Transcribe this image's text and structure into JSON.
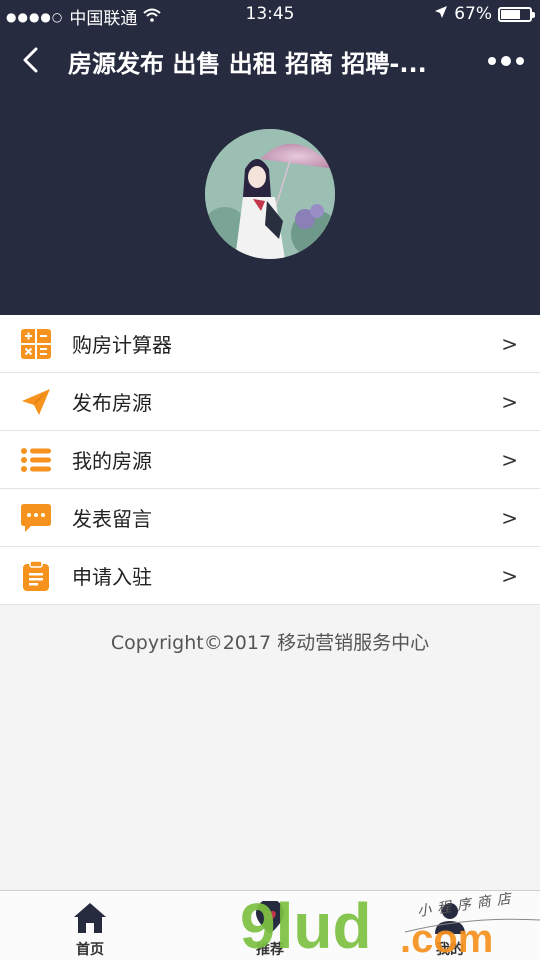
{
  "status_bar": {
    "signal": "●●●●○",
    "carrier": "中国联通",
    "time": "13:45",
    "battery": "67%",
    "battery_level": 0.67
  },
  "nav": {
    "title": "房源发布 出售 出租 招商 招聘-..."
  },
  "menu": {
    "items": [
      {
        "label": "购房计算器",
        "icon": "calculator-icon",
        "arrow": ">"
      },
      {
        "label": "发布房源",
        "icon": "paper-plane-icon",
        "arrow": ">"
      },
      {
        "label": "我的房源",
        "icon": "list-icon",
        "arrow": ">"
      },
      {
        "label": "发表留言",
        "icon": "message-icon",
        "arrow": ">"
      },
      {
        "label": "申请入驻",
        "icon": "clipboard-icon",
        "arrow": ">"
      }
    ]
  },
  "copyright": "Copyright©2017 移动营销服务中心",
  "tabs": [
    {
      "label": "首页",
      "icon": "home-icon"
    },
    {
      "label": "推荐",
      "icon": "heart-pin-icon"
    },
    {
      "label": "我的",
      "icon": "user-icon"
    }
  ],
  "watermark": {
    "text_main": "9lud",
    "text_com": ".com",
    "text_small": "小程序商店"
  },
  "colors": {
    "header_bg": "#262b40",
    "icon_orange": "#f6921e",
    "watermark_green": "#7dc242",
    "watermark_orange": "#f6921e"
  }
}
